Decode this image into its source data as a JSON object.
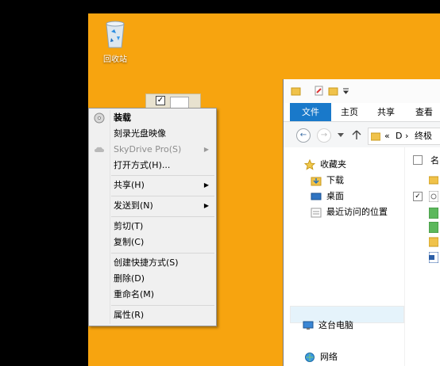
{
  "desktop": {
    "recycle_bin_label": "回收站"
  },
  "context_menu": {
    "items": [
      {
        "label": "装载",
        "bold": true
      },
      {
        "label": "刻录光盘映像"
      },
      {
        "label": "SkyDrive Pro(S)",
        "disabled": true,
        "submenu": true
      },
      {
        "label": "打开方式(H)..."
      },
      {
        "label": "共享(H)",
        "submenu": true
      },
      {
        "label": "发送到(N)",
        "submenu": true
      },
      {
        "label": "剪切(T)"
      },
      {
        "label": "复制(C)"
      },
      {
        "label": "创建快捷方式(S)"
      },
      {
        "label": "删除(D)"
      },
      {
        "label": "重命名(M)"
      },
      {
        "label": "属性(R)"
      }
    ],
    "submenu_arrow": "▶"
  },
  "explorer": {
    "tabs": [
      "文件",
      "主页",
      "共享",
      "查看"
    ],
    "address": {
      "chevron": "«",
      "drive": "D",
      "sep": "›",
      "folder": "终极"
    },
    "nav_pane": {
      "favorites": "收藏夹",
      "downloads": "下载",
      "desktop": "桌面",
      "recent": "最近访问的位置",
      "this_pc": "这台电脑",
      "network": "网络"
    },
    "content_header": "名"
  },
  "colors": {
    "desktop_bg": "#f7a40f",
    "file_tab": "#1979ca",
    "selection": "#e5f3fb"
  }
}
